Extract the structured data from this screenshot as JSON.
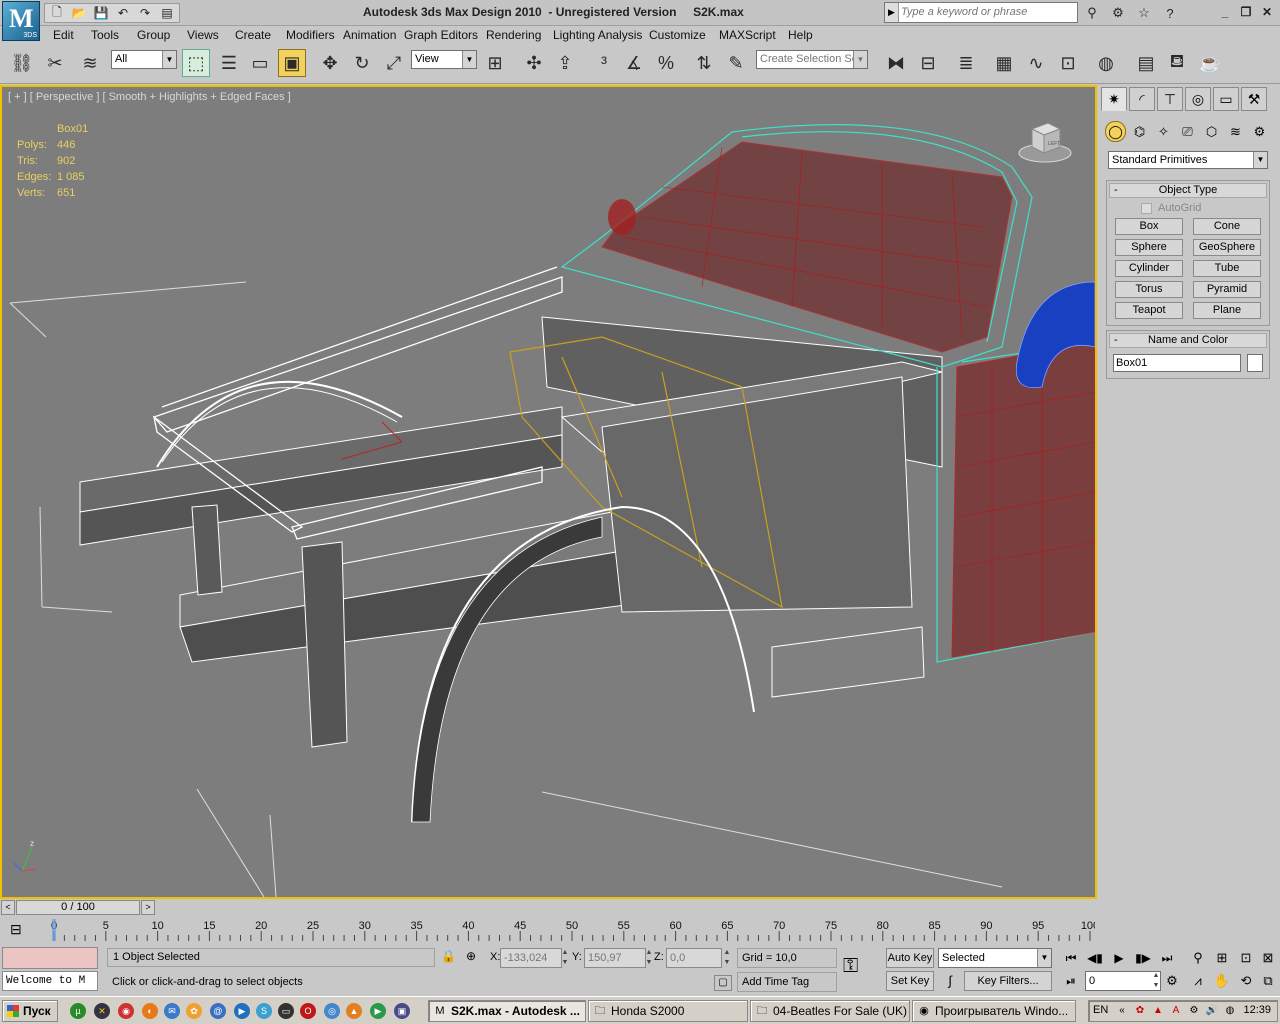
{
  "app": {
    "logo_text": "M",
    "logo_version": "3DS",
    "title": "Autodesk 3ds Max Design 2010  - Unregistered Version     S2K.max",
    "search_placeholder": "Type a keyword or phrase"
  },
  "qat": [
    "new-icon",
    "open-icon",
    "save-icon",
    "undo-icon",
    "redo-icon",
    "project-icon"
  ],
  "menu": [
    "Edit",
    "Tools",
    "Group",
    "Views",
    "Create",
    "Modifiers",
    "Animation",
    "Graph Editors",
    "Rendering",
    "Lighting Analysis",
    "Customize",
    "MAXScript",
    "Help"
  ],
  "toolbar": {
    "selection_filter": "All",
    "ref_coord": "View",
    "selection_set_placeholder": "Create Selection Se"
  },
  "viewport": {
    "label": "[ + ] [ Perspective ] [ Smooth + Highlights + Edged Faces ]",
    "object_name": "Box01",
    "stats": [
      {
        "key": "Polys:",
        "value": "446"
      },
      {
        "key": "Tris:",
        "value": "902"
      },
      {
        "key": "Edges:",
        "value": "1 085"
      },
      {
        "key": "Verts:",
        "value": "651"
      }
    ],
    "viewcube_label": "LEFT",
    "axis_label": "z"
  },
  "command_panel": {
    "category": "Standard Primitives",
    "object_type_title": "Object Type",
    "autogrid_label": "AutoGrid",
    "autogrid_checked": false,
    "object_buttons": [
      "Box",
      "Cone",
      "Sphere",
      "GeoSphere",
      "Cylinder",
      "Tube",
      "Torus",
      "Pyramid",
      "Teapot",
      "Plane"
    ],
    "name_color_title": "Name and Color",
    "object_name": "Box01",
    "object_color": "#ffffff"
  },
  "timeline": {
    "frame_display": "0 / 100",
    "current_frame": 0,
    "total_frames": 100,
    "tick_labels": [
      "0",
      "5",
      "10",
      "15",
      "20",
      "25",
      "30",
      "35",
      "40",
      "45",
      "50",
      "55",
      "60",
      "65",
      "70",
      "75",
      "80",
      "85",
      "90",
      "95",
      "100"
    ]
  },
  "status": {
    "listener_text": "Welcome to M",
    "selection_text": "1 Object Selected",
    "prompt_text": "Click or click-and-drag to select objects",
    "x_label": "X:",
    "x_value": "-133,024",
    "y_label": "Y:",
    "y_value": "150,97",
    "z_label": "Z:",
    "z_value": "0,0",
    "grid_text": "Grid = 10,0",
    "add_time_tag": "Add Time Tag",
    "auto_key": "Auto Key",
    "set_key": "Set Key",
    "key_mode": "Selected",
    "key_filters": "Key Filters...",
    "frame_value": "0"
  },
  "taskbar": {
    "start_label": "Пуск",
    "tasks": [
      {
        "label": "S2K.max - Autodesk ...",
        "icon": "3ds-max-icon",
        "active": true
      },
      {
        "label": "Honda S2000",
        "icon": "folder-icon",
        "active": false
      },
      {
        "label": "04-Beatles For Sale (UK) ...",
        "icon": "folder-icon",
        "active": false
      },
      {
        "label": "Проигрыватель Windo...",
        "icon": "media-player-icon",
        "active": false
      }
    ],
    "language": "EN",
    "clock": "12:39"
  },
  "colors": {
    "viewport_bg": "#7d7d7d",
    "viewport_border": "#f0c000",
    "stats_text": "#e8d060",
    "wire_cyan": "#40e0c8",
    "wire_red": "#c01010",
    "selection_gold": "#c8a020"
  }
}
